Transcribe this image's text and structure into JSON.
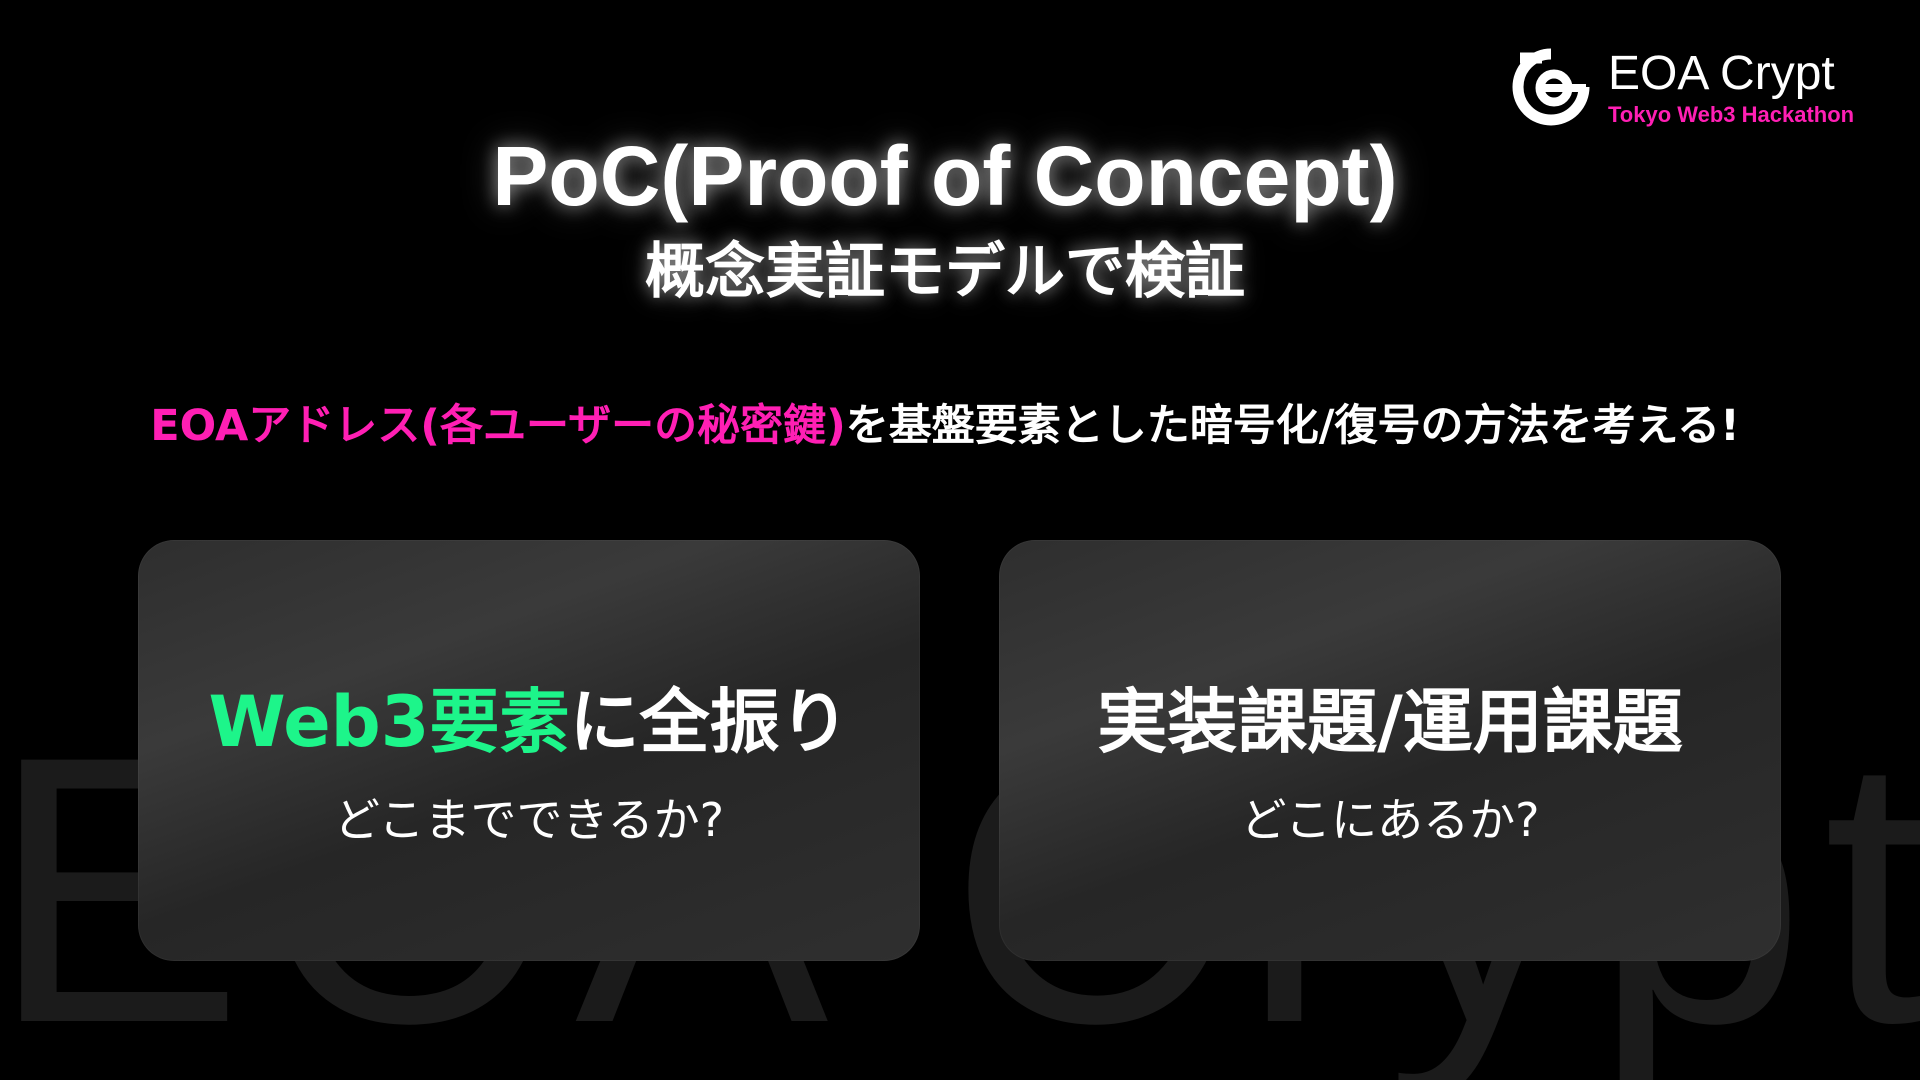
{
  "watermark": "EOA Crypt",
  "logo": {
    "title": "EOA Crypt",
    "subtitle": "Tokyo Web3 Hackathon",
    "accent_color": "#ff1fb4"
  },
  "title": "PoC(Proof of Concept)",
  "subtitle": "概念実証モデルで検証",
  "lead": {
    "highlight": "EOAアドレス(各ユーザーの秘密鍵)",
    "rest": "を基盤要素とした暗号化/復号の方法を考える!",
    "highlight_color": "#ff1fb4"
  },
  "cards": [
    {
      "heading_highlight": "Web3要素",
      "heading_rest": "に全振り",
      "sub": "どこまでできるか?",
      "highlight_color": "#1df58a"
    },
    {
      "heading_highlight": "",
      "heading_rest": "実装課題/運用課題",
      "sub": "どこにあるか?"
    }
  ]
}
